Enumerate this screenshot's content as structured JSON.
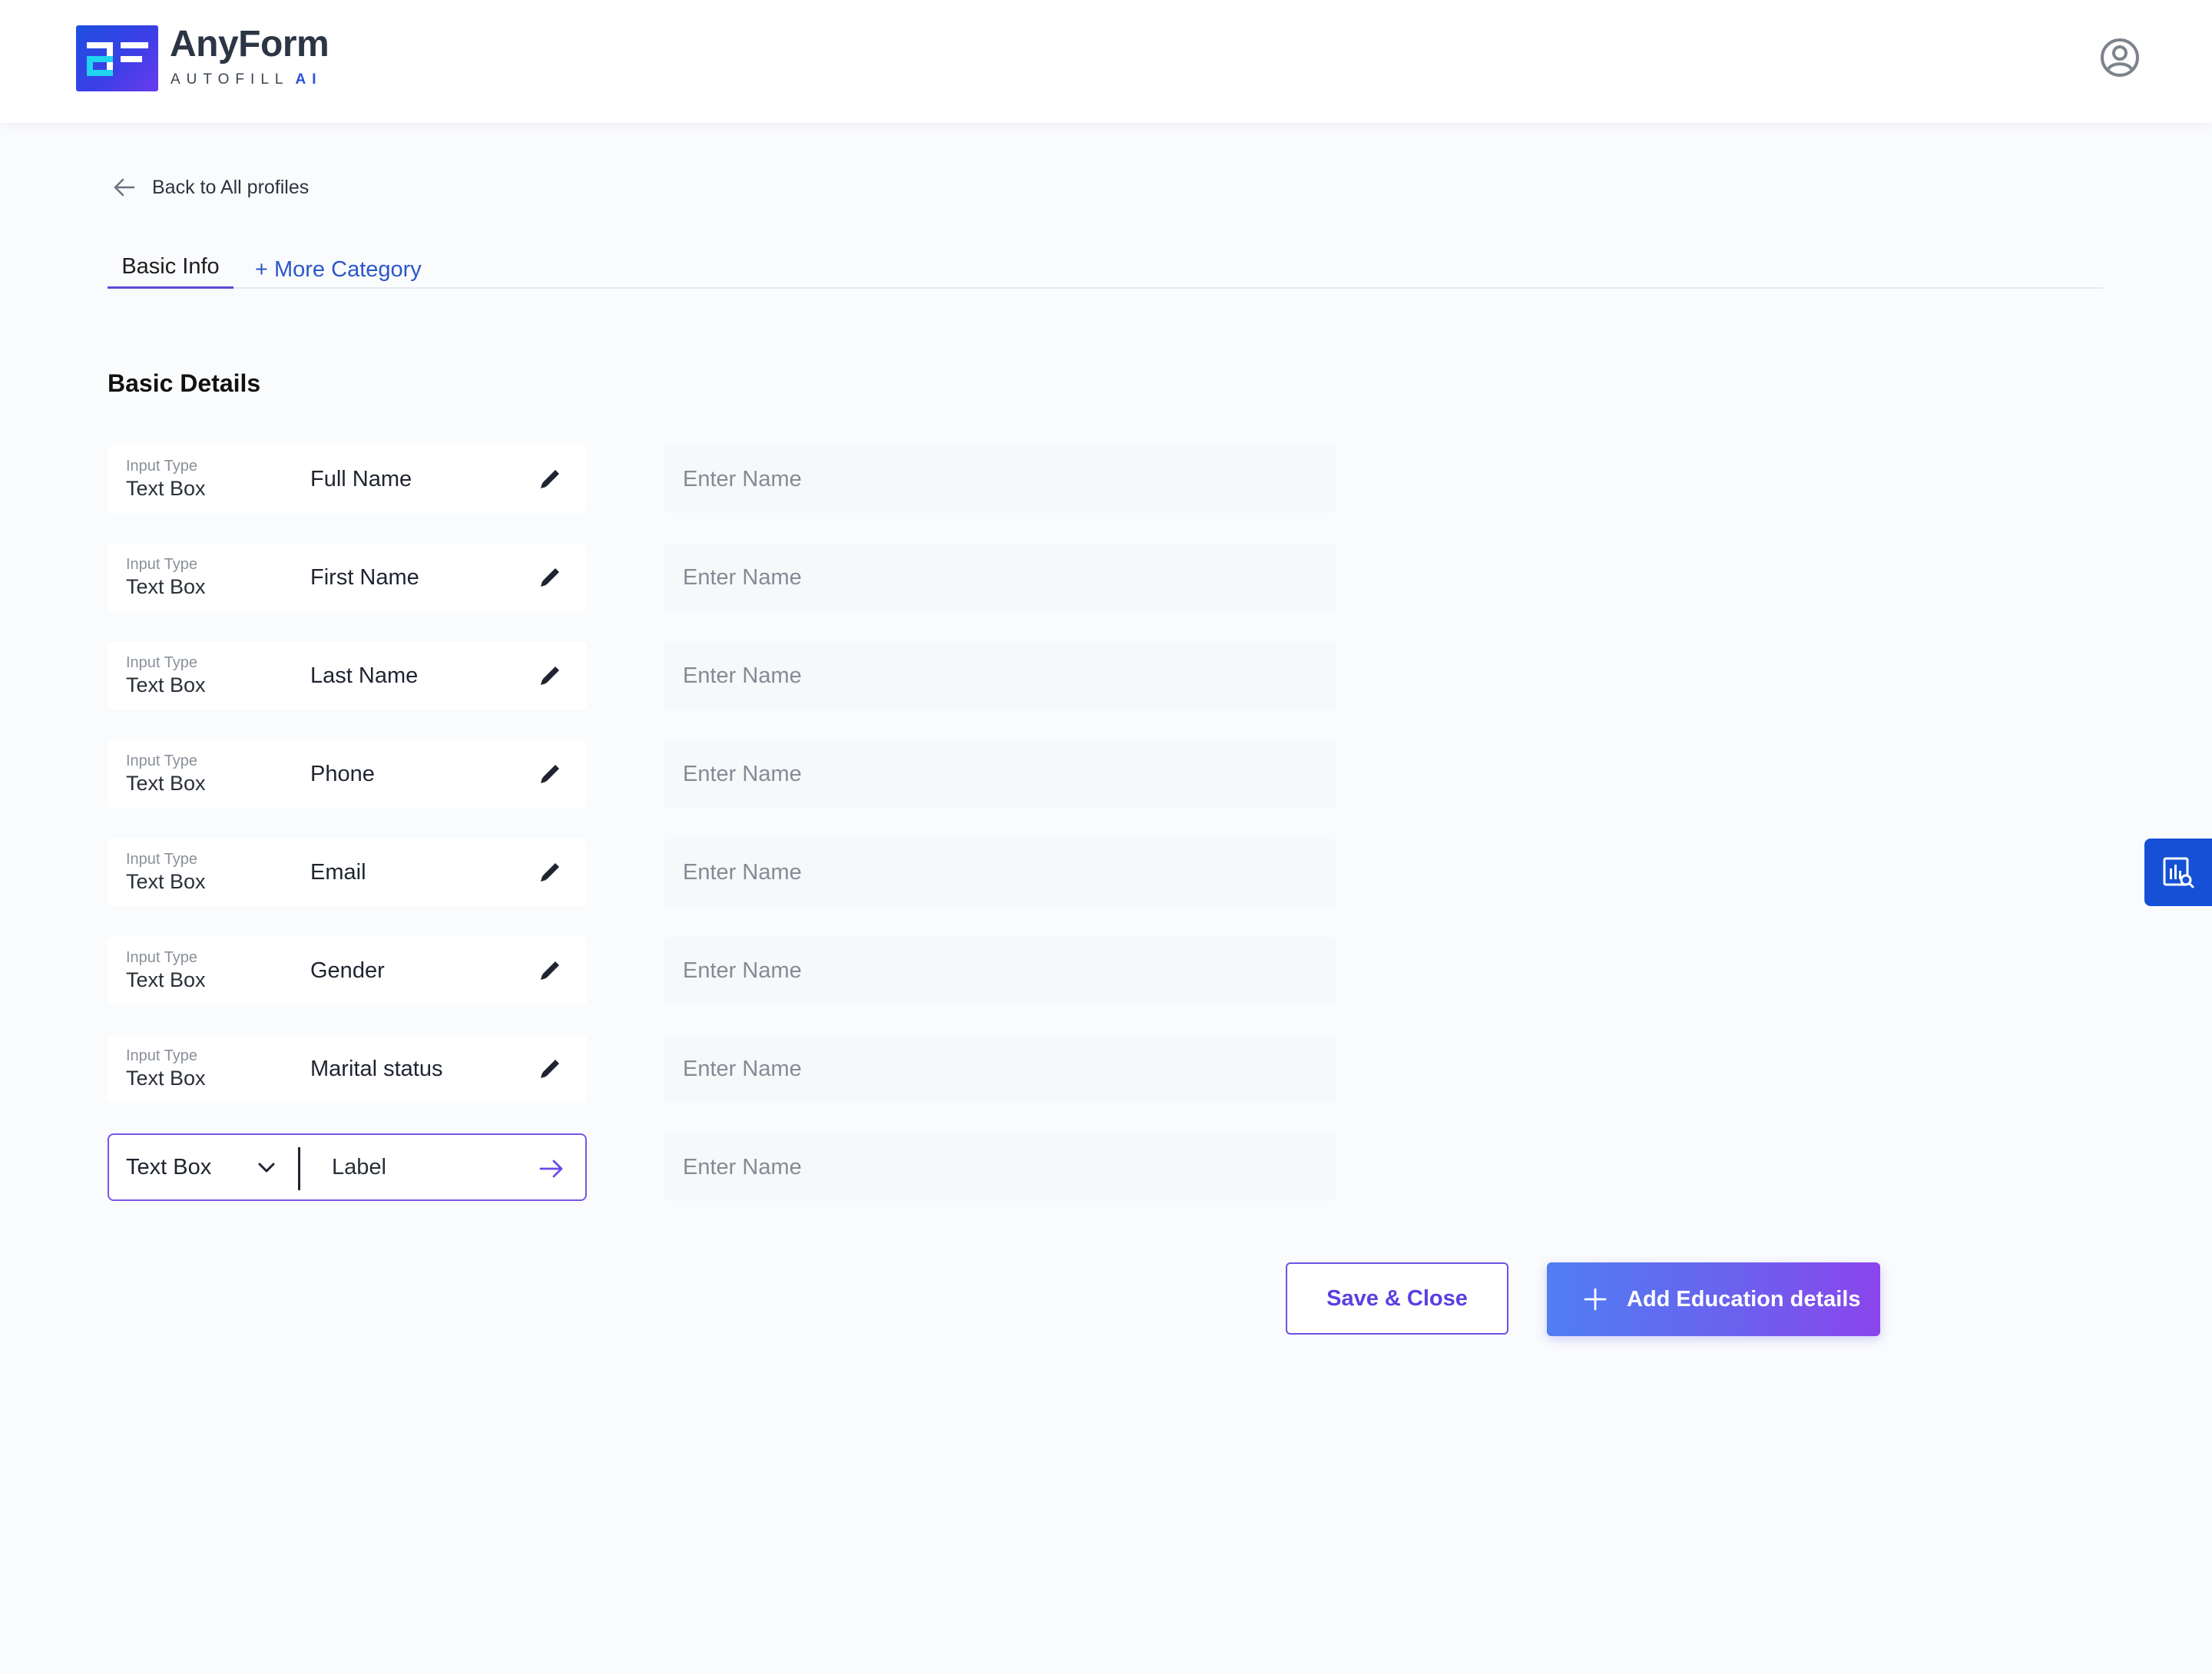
{
  "brand": {
    "name": "AnyForm",
    "tagline": "AUTOFILL",
    "tagline_ai": "AI",
    "accent": "#5b3fe0",
    "link": "#2a58c8"
  },
  "header": {
    "avatar_icon": "user-circle-icon"
  },
  "nav": {
    "back_label": "Back to All profiles"
  },
  "tabs": {
    "basic_info": "Basic Info",
    "more_category": "+ More Category"
  },
  "section": {
    "title": "Basic Details"
  },
  "fields": [
    {
      "caption": "Input Type",
      "type": "Text Box",
      "label": "Full Name",
      "placeholder": "Enter Name"
    },
    {
      "caption": "Input Type",
      "type": "Text Box",
      "label": "First Name",
      "placeholder": "Enter Name"
    },
    {
      "caption": "Input Type",
      "type": "Text Box",
      "label": "Last Name",
      "placeholder": "Enter Name"
    },
    {
      "caption": "Input Type",
      "type": "Text Box",
      "label": "Phone",
      "placeholder": "Enter Name"
    },
    {
      "caption": "Input Type",
      "type": "Text Box",
      "label": "Email",
      "placeholder": "Enter Name"
    },
    {
      "caption": "Input Type",
      "type": "Text Box",
      "label": "Gender",
      "placeholder": "Enter Name"
    },
    {
      "caption": "Input Type",
      "type": "Text Box",
      "label": "Marital status",
      "placeholder": "Enter Name"
    }
  ],
  "new_field": {
    "type_selected": "Text Box",
    "label_placeholder": "Label",
    "value_placeholder": "Enter Name"
  },
  "actions": {
    "save_close": "Save & Close",
    "add_education": "Add Education details"
  }
}
